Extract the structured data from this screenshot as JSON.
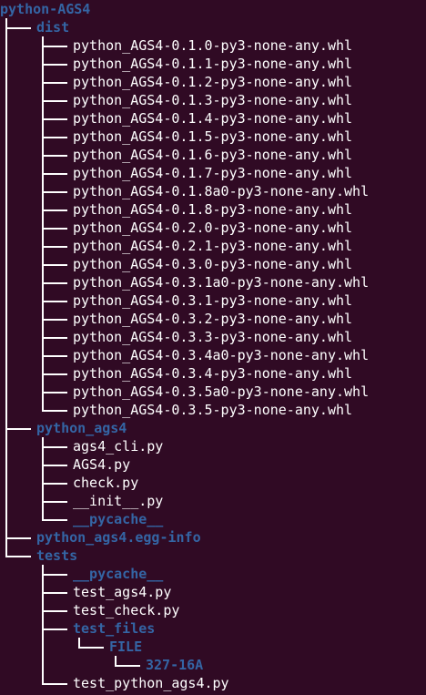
{
  "terminal": {
    "background": "#300a24",
    "file_color": "#ffffff",
    "dir_color": "#3465a4"
  },
  "tree": {
    "root": "python-AGS4",
    "nodes": [
      {
        "label": "dist",
        "type": "dir",
        "depth": 1,
        "last": false,
        "children": [
          {
            "label": "python_AGS4-0.1.0-py3-none-any.whl",
            "type": "file",
            "last": false
          },
          {
            "label": "python_AGS4-0.1.1-py3-none-any.whl",
            "type": "file",
            "last": false
          },
          {
            "label": "python_AGS4-0.1.2-py3-none-any.whl",
            "type": "file",
            "last": false
          },
          {
            "label": "python_AGS4-0.1.3-py3-none-any.whl",
            "type": "file",
            "last": false
          },
          {
            "label": "python_AGS4-0.1.4-py3-none-any.whl",
            "type": "file",
            "last": false
          },
          {
            "label": "python_AGS4-0.1.5-py3-none-any.whl",
            "type": "file",
            "last": false
          },
          {
            "label": "python_AGS4-0.1.6-py3-none-any.whl",
            "type": "file",
            "last": false
          },
          {
            "label": "python_AGS4-0.1.7-py3-none-any.whl",
            "type": "file",
            "last": false
          },
          {
            "label": "python_AGS4-0.1.8a0-py3-none-any.whl",
            "type": "file",
            "last": false
          },
          {
            "label": "python_AGS4-0.1.8-py3-none-any.whl",
            "type": "file",
            "last": false
          },
          {
            "label": "python_AGS4-0.2.0-py3-none-any.whl",
            "type": "file",
            "last": false
          },
          {
            "label": "python_AGS4-0.2.1-py3-none-any.whl",
            "type": "file",
            "last": false
          },
          {
            "label": "python_AGS4-0.3.0-py3-none-any.whl",
            "type": "file",
            "last": false
          },
          {
            "label": "python_AGS4-0.3.1a0-py3-none-any.whl",
            "type": "file",
            "last": false
          },
          {
            "label": "python_AGS4-0.3.1-py3-none-any.whl",
            "type": "file",
            "last": false
          },
          {
            "label": "python_AGS4-0.3.2-py3-none-any.whl",
            "type": "file",
            "last": false
          },
          {
            "label": "python_AGS4-0.3.3-py3-none-any.whl",
            "type": "file",
            "last": false
          },
          {
            "label": "python_AGS4-0.3.4a0-py3-none-any.whl",
            "type": "file",
            "last": false
          },
          {
            "label": "python_AGS4-0.3.4-py3-none-any.whl",
            "type": "file",
            "last": false
          },
          {
            "label": "python_AGS4-0.3.5a0-py3-none-any.whl",
            "type": "file",
            "last": false
          },
          {
            "label": "python_AGS4-0.3.5-py3-none-any.whl",
            "type": "file",
            "last": true
          }
        ]
      },
      {
        "label": "python_ags4",
        "type": "dir",
        "last": false,
        "children": [
          {
            "label": "ags4_cli.py",
            "type": "file",
            "last": false
          },
          {
            "label": "AGS4.py",
            "type": "file",
            "last": false
          },
          {
            "label": "check.py",
            "type": "file",
            "last": false
          },
          {
            "label": "__init__.py",
            "type": "file",
            "last": false
          },
          {
            "label": "__pycache__",
            "type": "dir",
            "last": true
          }
        ]
      },
      {
        "label": "python_ags4.egg-info",
        "type": "dir",
        "last": false
      },
      {
        "label": "tests",
        "type": "dir",
        "last": true,
        "children": [
          {
            "label": "__pycache__",
            "type": "dir",
            "last": false
          },
          {
            "label": "test_ags4.py",
            "type": "file",
            "last": false
          },
          {
            "label": "test_check.py",
            "type": "file",
            "last": false
          },
          {
            "label": "test_files",
            "type": "dir",
            "last": false,
            "children": [
              {
                "label": "FILE",
                "type": "dir",
                "last": true,
                "children": [
                  {
                    "label": "327-16A",
                    "type": "dir",
                    "last": true
                  }
                ]
              }
            ]
          },
          {
            "label": "test_python_ags4.py",
            "type": "file",
            "last": true
          }
        ]
      }
    ]
  }
}
